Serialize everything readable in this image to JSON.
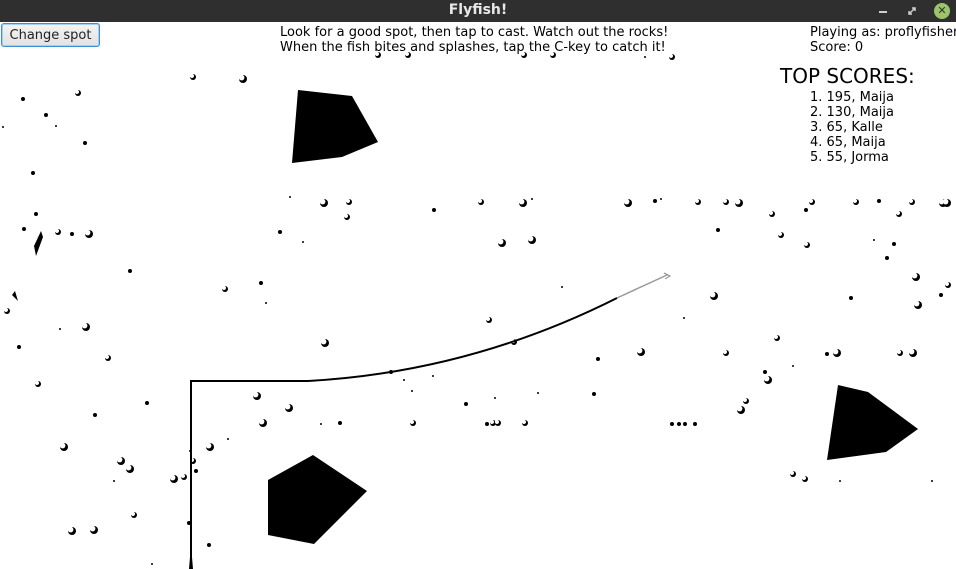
{
  "window": {
    "title": "Flyfish!"
  },
  "controls": {
    "change_spot_label": "Change spot"
  },
  "instructions": {
    "line1": "Look for a good spot, then tap to cast. Watch out the rocks!",
    "line2": "When the fish bites and splashes, tap the C-key to catch it!"
  },
  "player": {
    "playing_as": "Playing as: proflyfisher",
    "score": "Score: 0"
  },
  "top_scores": {
    "title": "TOP SCORES:",
    "entries": [
      "1. 195, Maija",
      "2. 130, Maija",
      "3. 65, Kalle",
      "4. 65, Maija",
      "5. 55, Jorma"
    ]
  },
  "colors": {
    "titlebar": "#2f2f2f",
    "close_button": "#9bc46a",
    "rock": "#000000",
    "fishing_line": "#000000",
    "leader": "#999999"
  }
}
